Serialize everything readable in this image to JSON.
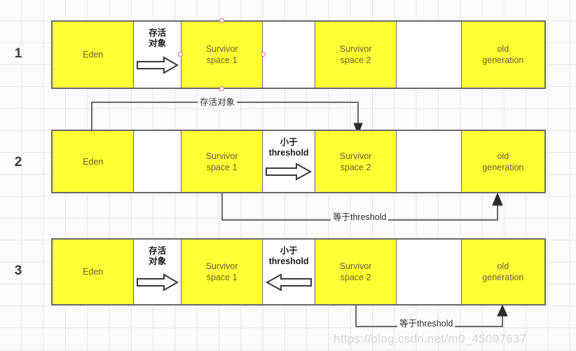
{
  "diagram": {
    "title": "JVM heap generational garbage collection object promotion",
    "watermark": "https://blog.csdn.net/m0_45097637",
    "colors": {
      "filled": "#ffff33",
      "empty": "#ffffff",
      "border": "#6b6b6b",
      "grid": "#e8e8e8",
      "background": "#fbfbfb",
      "handle": "#e8677d"
    },
    "rows": [
      {
        "label": "1",
        "cells": [
          {
            "name": "eden",
            "text": "Eden",
            "fill": "filled",
            "kind": "region"
          },
          {
            "name": "transfer-eden-to-s1",
            "text": "存活\n对象",
            "fill": "empty",
            "kind": "transfer",
            "arrow": "right"
          },
          {
            "name": "survivor-space-1",
            "text": "Survivor\nspace 1",
            "fill": "filled",
            "kind": "region",
            "selected": true
          },
          {
            "name": "gap-1",
            "text": "",
            "fill": "empty",
            "kind": "region"
          },
          {
            "name": "survivor-space-2",
            "text": "Survivor\nspace 2",
            "fill": "filled",
            "kind": "region"
          },
          {
            "name": "gap-2",
            "text": "",
            "fill": "empty",
            "kind": "region"
          },
          {
            "name": "old-generation",
            "text": "old\ngeneration",
            "fill": "filled",
            "kind": "region"
          }
        ]
      },
      {
        "label": "2",
        "cells": [
          {
            "name": "eden",
            "text": "Eden",
            "fill": "filled",
            "kind": "region"
          },
          {
            "name": "gap-0",
            "text": "",
            "fill": "empty",
            "kind": "region"
          },
          {
            "name": "survivor-space-1",
            "text": "Survivor\nspace 1",
            "fill": "filled",
            "kind": "region"
          },
          {
            "name": "transfer-s1-to-s2",
            "text": "小于\nthreshold",
            "fill": "empty",
            "kind": "transfer",
            "arrow": "right"
          },
          {
            "name": "survivor-space-2",
            "text": "Survivor\nspace 2",
            "fill": "filled",
            "kind": "region"
          },
          {
            "name": "gap-2",
            "text": "",
            "fill": "empty",
            "kind": "region"
          },
          {
            "name": "old-generation",
            "text": "old\ngeneration",
            "fill": "filled",
            "kind": "region"
          }
        ]
      },
      {
        "label": "3",
        "cells": [
          {
            "name": "eden",
            "text": "Eden",
            "fill": "filled",
            "kind": "region"
          },
          {
            "name": "transfer-eden-to-s1",
            "text": "存活\n对象",
            "fill": "empty",
            "kind": "transfer",
            "arrow": "right"
          },
          {
            "name": "survivor-space-1",
            "text": "Survivor\nspace 1",
            "fill": "filled",
            "kind": "region"
          },
          {
            "name": "transfer-s2-to-s1",
            "text": "小于\nthreshold",
            "fill": "empty",
            "kind": "transfer",
            "arrow": "left"
          },
          {
            "name": "survivor-space-2",
            "text": "Survivor\nspace 2",
            "fill": "filled",
            "kind": "region"
          },
          {
            "name": "gap-2",
            "text": "",
            "fill": "empty",
            "kind": "region"
          },
          {
            "name": "old-generation",
            "text": "old\ngeneration",
            "fill": "filled",
            "kind": "region"
          }
        ]
      }
    ],
    "connectors": [
      {
        "name": "connector-survivor-alive-objects",
        "label": "存活对象",
        "from": "row1-survivor-space-1",
        "to": "row2-survivor-space-2"
      },
      {
        "name": "connector-promote-row2",
        "label": "等于threshold",
        "from": "row2-survivor-space-1",
        "to": "row3-old-generation"
      },
      {
        "name": "connector-promote-row3",
        "label": "等于threshold",
        "from": "row3-survivor-space-2",
        "to": "row3-old-generation-bottom"
      }
    ]
  }
}
